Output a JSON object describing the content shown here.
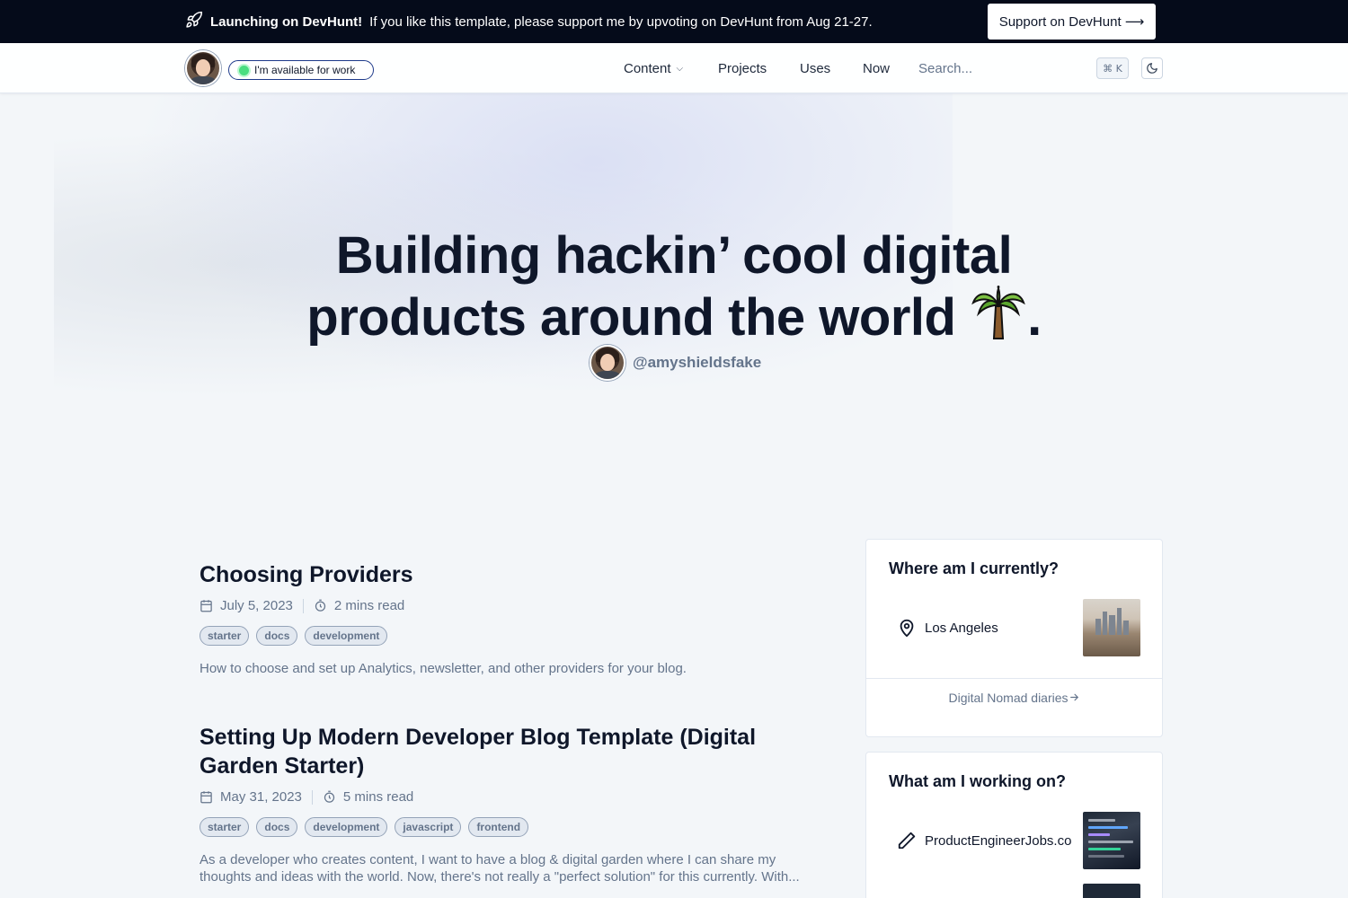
{
  "banner": {
    "bold": "Launching on DevHunt!",
    "text": "If you like this template, please support me by upvoting on DevHunt from Aug 21-27.",
    "button": "Support on DevHunt ⟶",
    "icon": "rocket-icon"
  },
  "nav": {
    "availability": "I'm available for work",
    "links": [
      "Content",
      "Projects",
      "Uses",
      "Now"
    ],
    "search_placeholder": "Search...",
    "shortcut": "⌘ K",
    "theme_icon": "moon-icon"
  },
  "hero": {
    "title_line1": "Building hackin’ cool digital",
    "title_line2": "products around the world",
    "title_end": ".",
    "handle": "@amyshieldsfake"
  },
  "posts": [
    {
      "title": "Choosing Providers",
      "date": "July 5, 2023",
      "read": "2 mins read",
      "tags": [
        "starter",
        "docs",
        "development"
      ],
      "excerpt": "How to choose and set up Analytics, newsletter, and other providers for your blog."
    },
    {
      "title": "Setting Up Modern Developer Blog Template (Digital Garden Starter)",
      "date": "May 31, 2023",
      "read": "5 mins read",
      "tags": [
        "starter",
        "docs",
        "development",
        "javascript",
        "frontend"
      ],
      "excerpt": "As a developer who creates content, I want to have a blog & digital garden where I can share my thoughts and ideas with the world. Now, there's not really a \"perfect solution\" for this currently. With..."
    }
  ],
  "sidebar": {
    "location": {
      "title": "Where am I currently?",
      "place": "Los Angeles",
      "link": "Digital Nomad diaries"
    },
    "working": {
      "title": "What am I working on?",
      "project": "ProductEngineerJobs.co"
    }
  },
  "colors": {
    "banner_bg": "#050b1a",
    "page_bg": "#f3f6f9",
    "text": "#0f172a",
    "muted": "#64748b",
    "available_dot": "#4ade80"
  }
}
